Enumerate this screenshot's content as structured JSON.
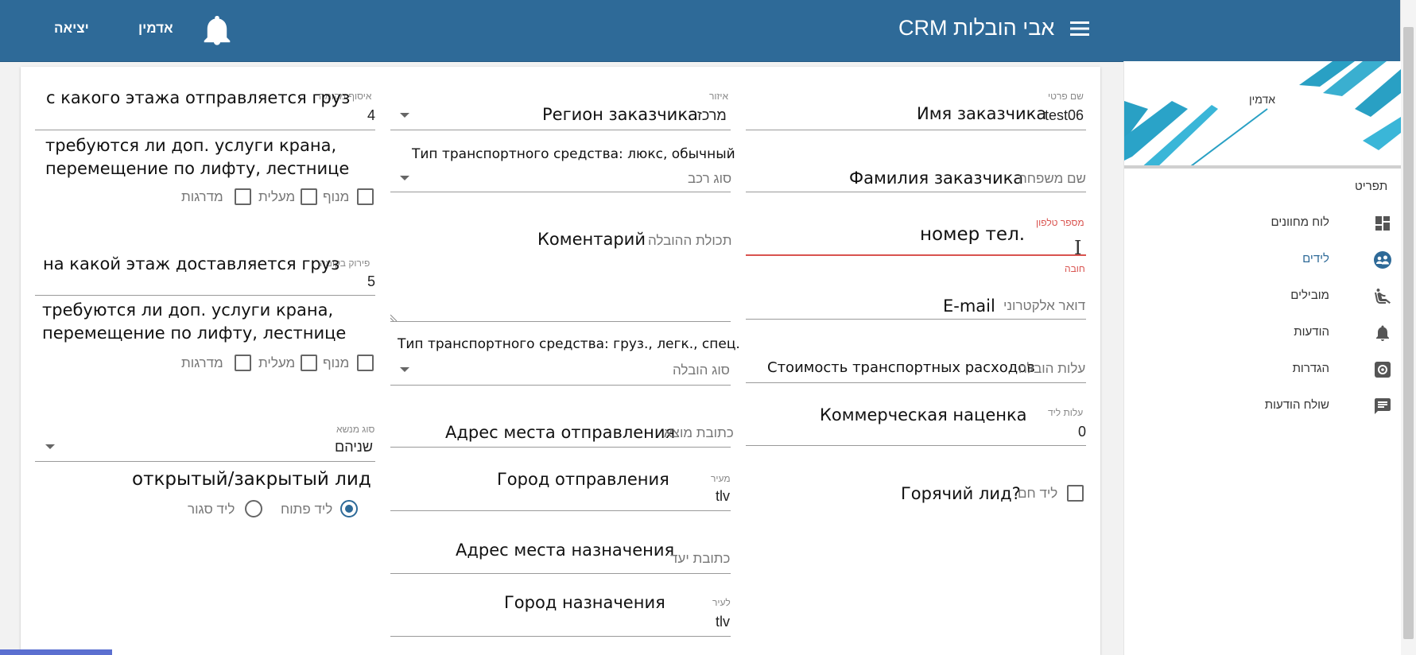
{
  "header": {
    "app_title": "CRM אבי הובלות",
    "user_label": "אדמין",
    "logout_label": "יציאה"
  },
  "sidebar": {
    "user_name": "אדמין",
    "menu_title": "תפריט",
    "items": [
      {
        "label": "לוח מחוונים",
        "icon": "dashboard-icon"
      },
      {
        "label": "לידים",
        "icon": "leads-icon"
      },
      {
        "label": "מובילים",
        "icon": "seat-icon"
      },
      {
        "label": "הודעות",
        "icon": "bell-icon"
      },
      {
        "label": "הגדרות",
        "icon": "settings-icon"
      },
      {
        "label": "שולח הודעות",
        "icon": "message-icon"
      }
    ]
  },
  "col_right": {
    "first_name": {
      "label": "שם פרטי",
      "value": "test06",
      "annotation": "Имя заказчика"
    },
    "last_name": {
      "placeholder": "שם משפחה",
      "annotation": "Фамилия заказчика"
    },
    "phone": {
      "label": "מספר טלפון",
      "error": "חובה",
      "annotation": "номер тел."
    },
    "email": {
      "placeholder": "דואר אלקטרוני",
      "annotation": "E-mail"
    },
    "cost": {
      "placeholder": "עלות הובלה",
      "annotation": "Стоимость транспортных расходов"
    },
    "lead_cost": {
      "label": "עלות ליד",
      "value": "0",
      "annotation": "Коммерческая наценка"
    },
    "hot_lead": {
      "label": "ליד חם",
      "annotation": "Горячий лид?"
    }
  },
  "col_middle": {
    "region": {
      "label": "איזור",
      "value": "מרכז",
      "annotation": "Регион заказчика"
    },
    "vehicle_type": {
      "placeholder": "סוג רכב",
      "annotation": "Тип транспортного средства: люкс, обычный"
    },
    "contents": {
      "placeholder": "תכולת ההובלה",
      "annotation": "Коментарий"
    },
    "transport_type": {
      "placeholder": "סוג הובלה",
      "annotation": "Тип транспортного средства: груз., легк., спец."
    },
    "origin_address": {
      "placeholder": "כתובת מוצא",
      "annotation": "Адрес места отправления"
    },
    "origin_city": {
      "label": "מעיר",
      "value": "tlv",
      "annotation": "Город отправления"
    },
    "dest_address": {
      "placeholder": "כתובת יעד",
      "annotation": "Адрес места назначения"
    },
    "dest_city": {
      "label": "לעיר",
      "value": "tlv",
      "annotation": "Город назначения"
    }
  },
  "col_left": {
    "pickup_floor": {
      "label": "איסוף מקומה",
      "value": "4",
      "annotation": "с какого этажа отправляется груз"
    },
    "pickup_services_annotation_1": "требуются ли доп. услуги крана,",
    "pickup_services_annotation_2": "перемещение по лифту, лестнице",
    "dropoff_floor": {
      "label": "פירוק בקומה",
      "value": "5",
      "annotation": "на какой этаж доставляется груз"
    },
    "dropoff_services_annotation_1": "требуются ли доп. услуги крана,",
    "dropoff_services_annotation_2": "перемещение по лифту, лестнице",
    "options": {
      "crane": "מנוף",
      "elevator": "מעלית",
      "stairs": "מדרגות"
    },
    "subject": {
      "label": "סוג מנשא",
      "value": "שניהם"
    },
    "status_annotation": "открытый/закрытый лид",
    "status_open": "ליד פתוח",
    "status_closed": "ליד סגור"
  }
}
